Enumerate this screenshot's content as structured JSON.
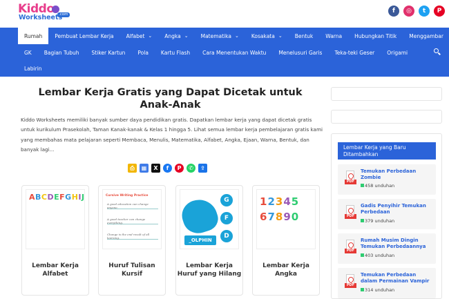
{
  "header": {
    "logo_line1": "Kiddo",
    "logo_line2": "Worksheets",
    "logo_com": ".com",
    "socials": [
      "facebook-icon",
      "instagram-icon",
      "twitter-icon",
      "pinterest-icon"
    ]
  },
  "nav": {
    "row1": [
      {
        "label": "Rumah",
        "active": true,
        "dropdown": false
      },
      {
        "label": "Pembuat Lembar Kerja",
        "dropdown": false
      },
      {
        "label": "Alfabet",
        "dropdown": true
      },
      {
        "label": "Angka",
        "dropdown": true
      },
      {
        "label": "Matematika",
        "dropdown": true
      },
      {
        "label": "Kosakata",
        "dropdown": true
      },
      {
        "label": "Bentuk",
        "dropdown": false
      },
      {
        "label": "Warna",
        "dropdown": false
      },
      {
        "label": "Hubungkan Titik",
        "dropdown": false
      },
      {
        "label": "Menggambar",
        "dropdown": false
      }
    ],
    "row2": [
      "GK",
      "Bagian Tubuh",
      "Stiker Kartun",
      "Pola",
      "Kartu Flash",
      "Cara Menentukan Waktu",
      "Menelusuri Garis",
      "Teka-teki Geser",
      "Origami"
    ],
    "row3": [
      "Labirin"
    ]
  },
  "main": {
    "title": "Lembar Kerja Gratis yang Dapat Dicetak untuk Anak-Anak",
    "intro": "Kiddo Worksheets memiliki banyak sumber daya pendidikan gratis. Dapatkan lembar kerja yang dapat dicetak gratis untuk kurikulum Prasekolah, Taman Kanak-kanak & Kelas 1 hingga 5. Lihat semua lembar kerja pembelajaran gratis kami yang membahas mata pelajaran seperti Membaca, Menulis, Matematika, Alfabet, Angka, Ejaan, Warna, Bentuk, dan banyak lagi..."
  },
  "share": [
    "print-icon",
    "grid-icon",
    "x-icon",
    "facebook-icon",
    "pinterest-icon",
    "whatsapp-icon",
    "share-icon"
  ],
  "cards": [
    {
      "caption": "Lembar Kerja Alfabet",
      "letters": "ABCDEFGHIJKLMNOPQRSTUVWXYZ"
    },
    {
      "caption": "Huruf Tulisan Kursif",
      "heading": "Cursive Writing Practice",
      "lines": [
        "A good education can change anyone.",
        "A good teacher can change everything.",
        "Change is the end result of all learning."
      ]
    },
    {
      "caption": "Lembar Kerja Huruf yang Hilang",
      "options": [
        "G",
        "F",
        "D"
      ],
      "word": "_OLPHIN"
    },
    {
      "caption": "Lembar Kerja Angka",
      "digits": "12345 67890"
    }
  ],
  "sidebar": {
    "heading": "Lembar Kerja yang Baru Ditambahkan",
    "pdf_label": "PDF",
    "downloads": [
      {
        "title": "Temukan Perbedaan Zombie",
        "count": "458 unduhan"
      },
      {
        "title": "Gadis Penyihir Temukan Perbedaan",
        "count": "379 unduhan"
      },
      {
        "title": "Rumah Musim Dingin Temukan Perbedaannya",
        "count": "403 unduhan"
      },
      {
        "title": "Temukan Perbedaan dalam Permainan Vampir",
        "count": "314 unduhan"
      }
    ]
  },
  "colors": {
    "nav": "#2b63d9",
    "accent_pink": "#e83e8c",
    "pdf_red": "#e53935"
  }
}
